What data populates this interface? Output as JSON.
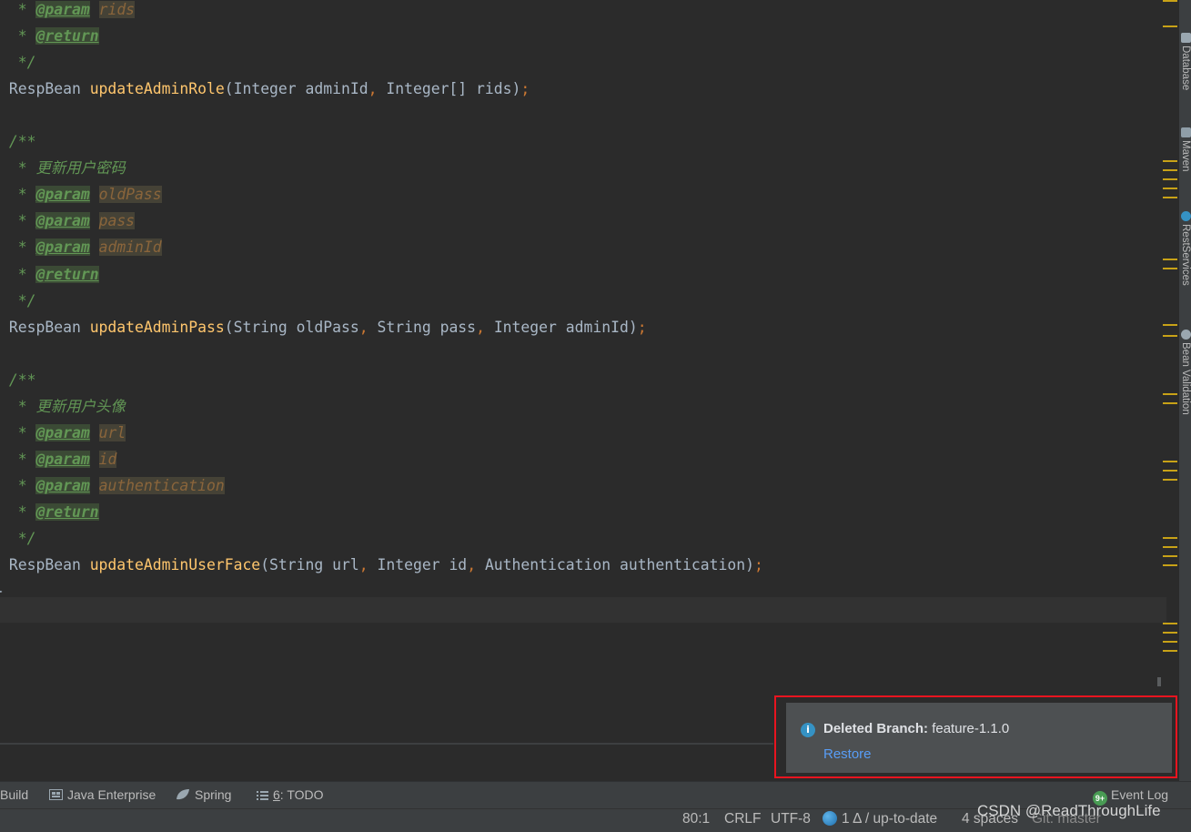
{
  "editor": {
    "code_lines": [
      {
        "parts": [
          {
            "c": "cmt",
            "t": "  * "
          },
          {
            "c": "tag",
            "t": "@param"
          },
          {
            "c": "cmt",
            "t": " "
          },
          {
            "c": "pname",
            "t": "rids"
          }
        ]
      },
      {
        "parts": [
          {
            "c": "cmt",
            "t": "  * "
          },
          {
            "c": "tag",
            "t": "@return"
          }
        ]
      },
      {
        "parts": [
          {
            "c": "cmt",
            "t": "  */"
          }
        ]
      },
      {
        "parts": [
          {
            "c": "plain",
            "t": " RespBean "
          },
          {
            "c": "fn",
            "t": "updateAdminRole"
          },
          {
            "c": "plain",
            "t": "(Integer adminId"
          },
          {
            "c": "punc",
            "t": ", "
          },
          {
            "c": "plain",
            "t": "Integer[] rids)"
          },
          {
            "c": "punc",
            "t": ";"
          }
        ]
      },
      {
        "parts": []
      },
      {
        "parts": [
          {
            "c": "cmt",
            "t": " /**"
          }
        ]
      },
      {
        "parts": [
          {
            "c": "cmt",
            "t": "  * "
          },
          {
            "c": "cn",
            "t": "更新用户密码"
          }
        ]
      },
      {
        "parts": [
          {
            "c": "cmt",
            "t": "  * "
          },
          {
            "c": "tag",
            "t": "@param"
          },
          {
            "c": "cmt",
            "t": " "
          },
          {
            "c": "pname",
            "t": "oldPass"
          }
        ]
      },
      {
        "parts": [
          {
            "c": "cmt",
            "t": "  * "
          },
          {
            "c": "tag",
            "t": "@param"
          },
          {
            "c": "cmt",
            "t": " "
          },
          {
            "c": "pname",
            "t": "pass"
          }
        ]
      },
      {
        "parts": [
          {
            "c": "cmt",
            "t": "  * "
          },
          {
            "c": "tag",
            "t": "@param"
          },
          {
            "c": "cmt",
            "t": " "
          },
          {
            "c": "pname",
            "t": "adminId"
          }
        ]
      },
      {
        "parts": [
          {
            "c": "cmt",
            "t": "  * "
          },
          {
            "c": "tag",
            "t": "@return"
          }
        ]
      },
      {
        "parts": [
          {
            "c": "cmt",
            "t": "  */"
          }
        ]
      },
      {
        "parts": [
          {
            "c": "plain",
            "t": " RespBean "
          },
          {
            "c": "fn",
            "t": "updateAdminPass"
          },
          {
            "c": "plain",
            "t": "(String oldPass"
          },
          {
            "c": "punc",
            "t": ", "
          },
          {
            "c": "plain",
            "t": "String pass"
          },
          {
            "c": "punc",
            "t": ", "
          },
          {
            "c": "plain",
            "t": "Integer adminId)"
          },
          {
            "c": "punc",
            "t": ";"
          }
        ]
      },
      {
        "parts": []
      },
      {
        "parts": [
          {
            "c": "cmt",
            "t": " /**"
          }
        ]
      },
      {
        "parts": [
          {
            "c": "cmt",
            "t": "  * "
          },
          {
            "c": "cn",
            "t": "更新用户头像"
          }
        ]
      },
      {
        "parts": [
          {
            "c": "cmt",
            "t": "  * "
          },
          {
            "c": "tag",
            "t": "@param"
          },
          {
            "c": "cmt",
            "t": " "
          },
          {
            "c": "pname",
            "t": "url"
          }
        ]
      },
      {
        "parts": [
          {
            "c": "cmt",
            "t": "  * "
          },
          {
            "c": "tag",
            "t": "@param"
          },
          {
            "c": "cmt",
            "t": " "
          },
          {
            "c": "pname",
            "t": "id"
          }
        ]
      },
      {
        "parts": [
          {
            "c": "cmt",
            "t": "  * "
          },
          {
            "c": "tag",
            "t": "@param"
          },
          {
            "c": "cmt",
            "t": " "
          },
          {
            "c": "pname",
            "t": "authentication"
          }
        ]
      },
      {
        "parts": [
          {
            "c": "cmt",
            "t": "  * "
          },
          {
            "c": "tag",
            "t": "@return"
          }
        ]
      },
      {
        "parts": [
          {
            "c": "cmt",
            "t": "  */"
          }
        ]
      },
      {
        "parts": [
          {
            "c": "plain",
            "t": " RespBean "
          },
          {
            "c": "fn",
            "t": "updateAdminUserFace"
          },
          {
            "c": "plain",
            "t": "(String url"
          },
          {
            "c": "punc",
            "t": ", "
          },
          {
            "c": "plain",
            "t": "Integer id"
          },
          {
            "c": "punc",
            "t": ", "
          },
          {
            "c": "plain",
            "t": "Authentication authentication)"
          },
          {
            "c": "punc",
            "t": ";"
          }
        ]
      },
      {
        "parts": [
          {
            "c": "plain",
            "t": "}"
          }
        ]
      }
    ]
  },
  "right_tool_tabs": [
    {
      "label": "Database",
      "icon": "database-icon"
    },
    {
      "label": "Maven",
      "icon": "maven-icon"
    },
    {
      "label": "RestServices",
      "icon": "rest-services-icon"
    },
    {
      "label": "Bean Validation",
      "icon": "bean-validation-icon"
    }
  ],
  "notification": {
    "icon": "info-icon",
    "title_bold": "Deleted Branch:",
    "title_rest": "feature-1.1.0",
    "action": "Restore"
  },
  "tool_bar": {
    "build": "Build",
    "java_enterprise": "Java Enterprise",
    "spring": "Spring",
    "todo_number": "6",
    "todo_label": ": TODO",
    "event_log_badge": "9+",
    "event_log": "Event Log"
  },
  "status_bar": {
    "position": "80:1",
    "line_separator": "CRLF",
    "encoding": "UTF-8",
    "vcs_changes": "1 Δ / up-to-date",
    "indent": "4 spaces",
    "git_branch": "Git: master"
  },
  "watermark": "CSDN @ReadThroughLife",
  "colors": {
    "editor_bg": "#2b2b2b",
    "notification_border": "#e8141f",
    "link": "#589df6",
    "marker": "#c8a217"
  }
}
